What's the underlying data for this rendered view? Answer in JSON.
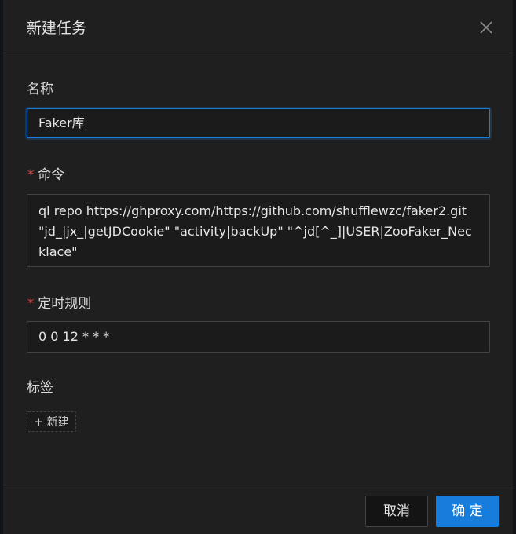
{
  "modal": {
    "title": "新建任务",
    "close_icon": "close-icon"
  },
  "form": {
    "name": {
      "label": "名称",
      "value": "Faker库"
    },
    "command": {
      "required_mark": "*",
      "label": "命令",
      "value": "ql repo https://ghproxy.com/https://github.com/shufflewzc/faker2.git \"jd_|jx_|getJDCookie\" \"activity|backUp\" \"^jd[^_]|USER|ZooFaker_Necklace\""
    },
    "schedule": {
      "required_mark": "*",
      "label": "定时规则",
      "value": "0 0 12 * * *"
    },
    "tags": {
      "label": "标签",
      "add_icon": "plus-icon",
      "add_label": "新建"
    }
  },
  "footer": {
    "cancel_label": "取消",
    "ok_label": "确 定"
  },
  "colors": {
    "primary": "#177ddc",
    "required": "#e04848",
    "modal_bg": "#1f1f1f"
  }
}
